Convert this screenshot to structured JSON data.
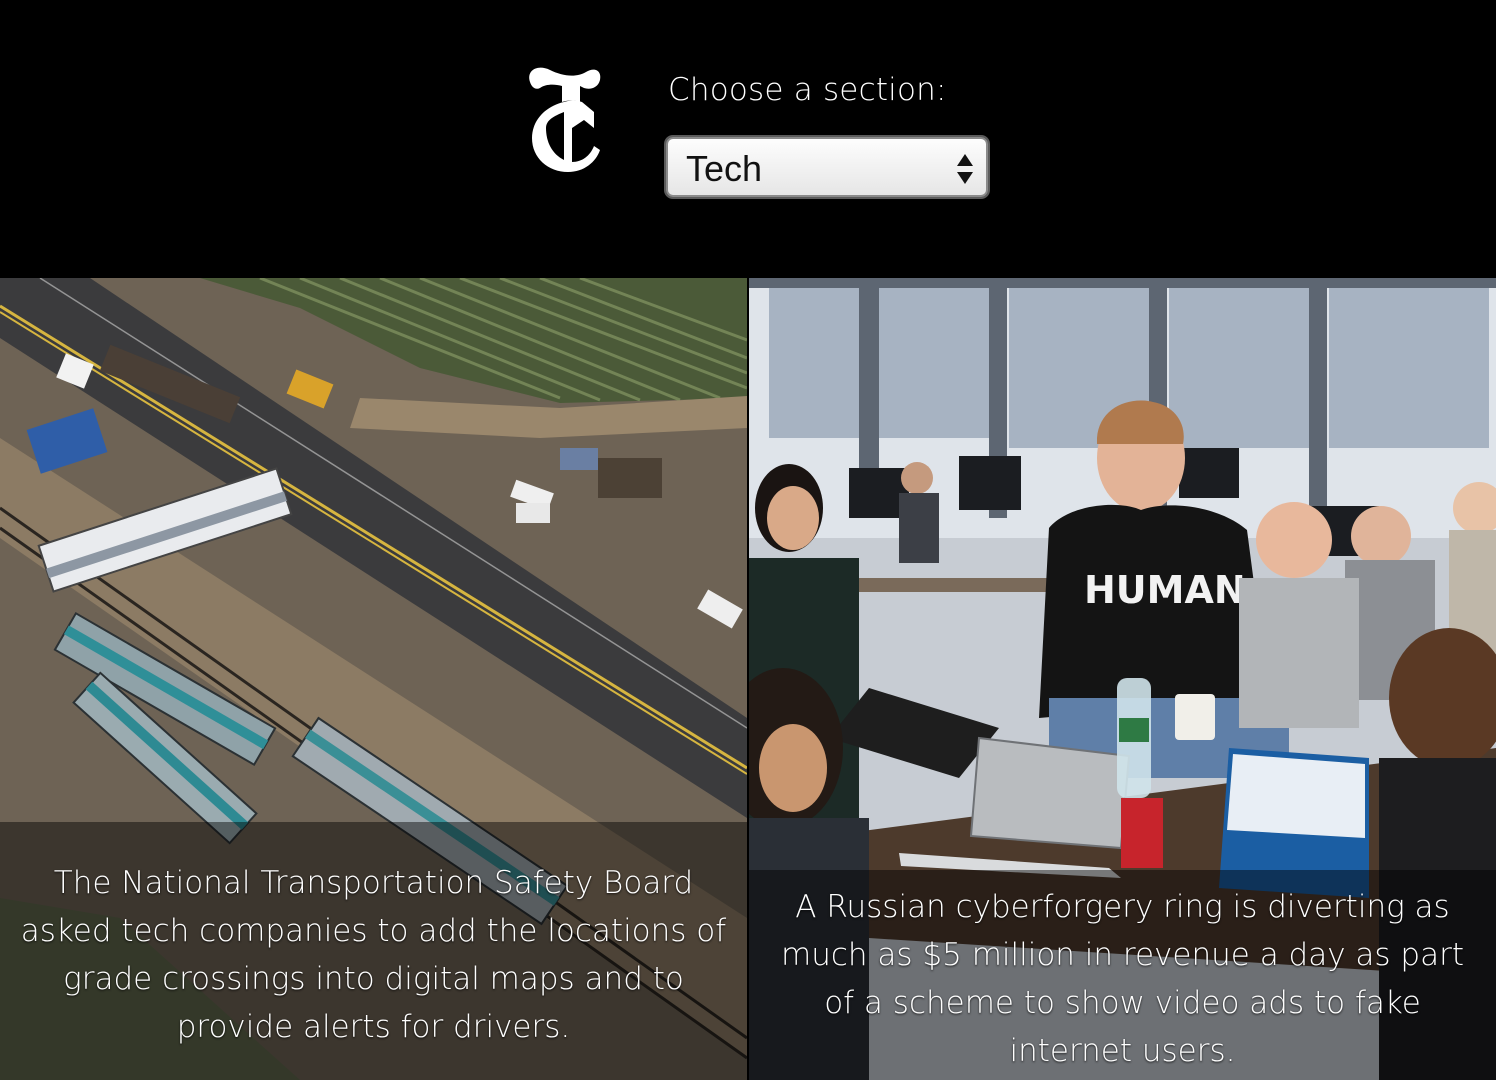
{
  "header": {
    "logo_icon": "nyt-t-logo",
    "section_label": "Choose a section:",
    "section_select": {
      "selected": "Tech",
      "icon": "select-arrows-icon"
    }
  },
  "stories": [
    {
      "image_alt": "Aerial view of derailed train cars at a grade crossing",
      "summary": "The National Transportation Safety Board asked tech companies to add the locations of grade crossings into digital maps and to provide alerts for drivers."
    },
    {
      "image_alt": "People working on laptops around a table in an office",
      "summary": "A Russian cyberforgery ring is diverting as much as $5 million in revenue a day as part of a scheme to show video ads to fake internet users."
    }
  ]
}
